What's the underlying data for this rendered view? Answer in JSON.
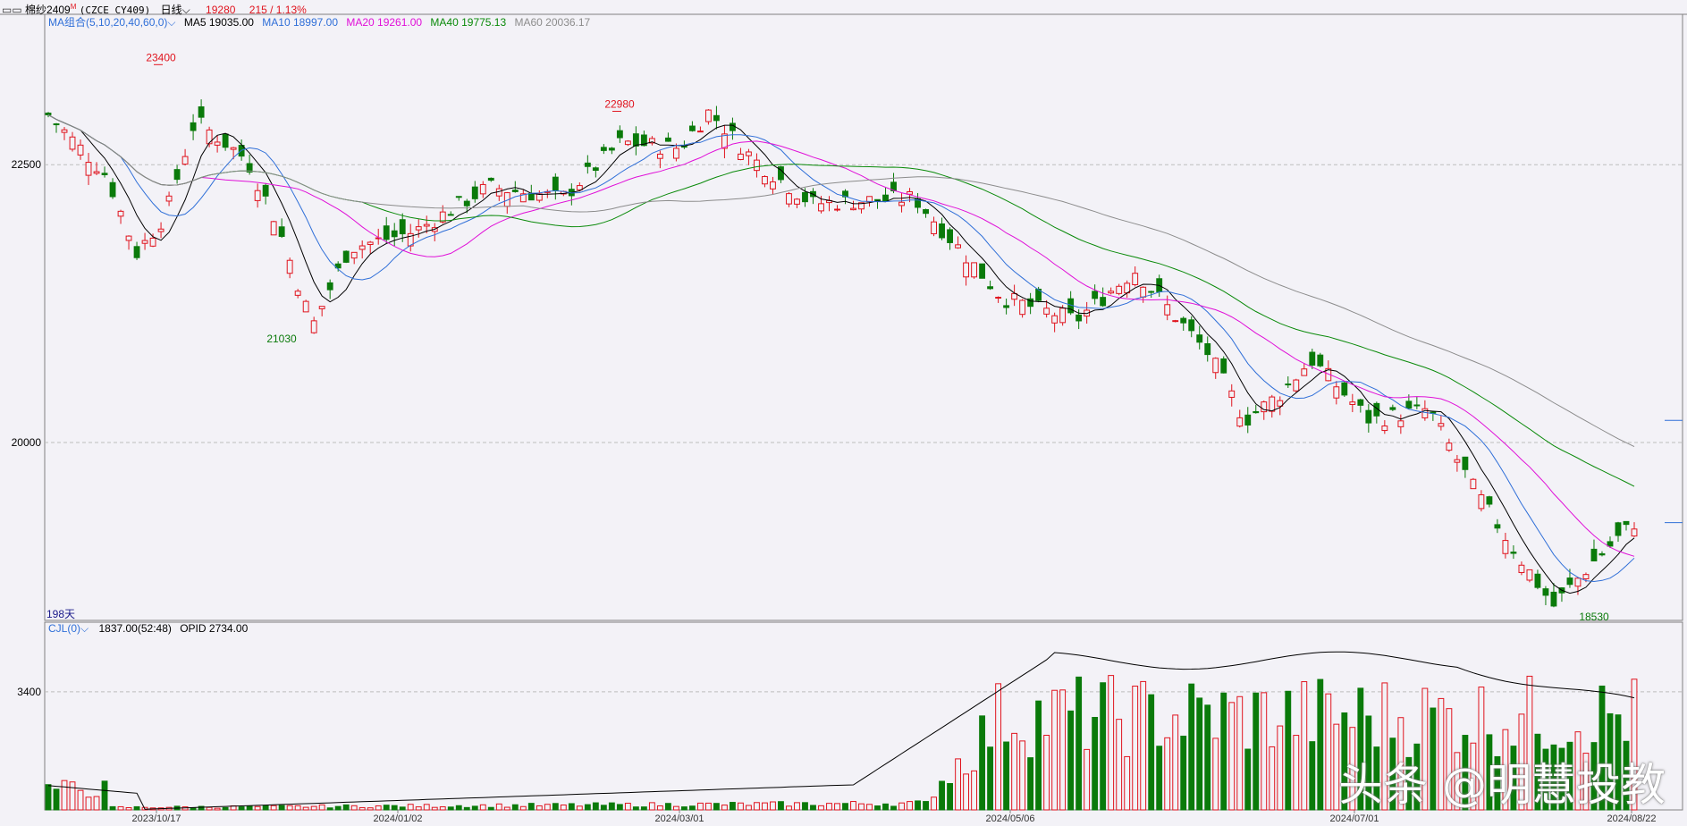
{
  "header": {
    "symbol": "棉纱2409",
    "symbol_sup": "M",
    "contract": "(CZCE CY409)",
    "period": "日线",
    "price": "19280",
    "change": "215 / 1.13%"
  },
  "ma_legend": {
    "label": "MA组合(5,10,20,40,60,0)",
    "items": [
      {
        "text": "MA5 19035.00",
        "color": "#000000"
      },
      {
        "text": "MA10 18997.00",
        "color": "#2f6fd8"
      },
      {
        "text": "MA20 19261.00",
        "color": "#e010d8"
      },
      {
        "text": "MA40 19775.13",
        "color": "#0a8a0a"
      },
      {
        "text": "MA60 20036.17",
        "color": "#8c8c8c"
      }
    ]
  },
  "vol_legend": {
    "label": "CJL(0)",
    "value": "1837.00(52:48)",
    "opid": "OPID 2734.00"
  },
  "days_label": "198天",
  "watermark": "头条 @明慧投教",
  "colors": {
    "up": "#e0141e",
    "down": "#0a7a0a",
    "grid": "#bdbdbd",
    "axis": "#808080",
    "bg": "#f3f2f7"
  },
  "chart_data": {
    "type": "candlestick",
    "price_axis": {
      "ticks": [
        "22500",
        "20000"
      ],
      "range": [
        18400,
        23700
      ]
    },
    "volume_axis": {
      "ticks": [
        "3400"
      ],
      "range": [
        0,
        5300
      ]
    },
    "x_ticks": [
      "2023/10/17",
      "2024/01/02",
      "2024/03/01",
      "2024/05/06",
      "2024/07/01",
      "2024/08/22"
    ],
    "annotations": [
      {
        "text": "23400",
        "value": 23400,
        "kind": "high"
      },
      {
        "text": "21030",
        "value": 21030,
        "kind": "low"
      },
      {
        "text": "22980",
        "value": 22980,
        "kind": "high"
      },
      {
        "text": "18530",
        "value": 18530,
        "kind": "low"
      }
    ],
    "ma_series_names": [
      "MA5",
      "MA10",
      "MA20",
      "MA40",
      "MA60"
    ]
  }
}
